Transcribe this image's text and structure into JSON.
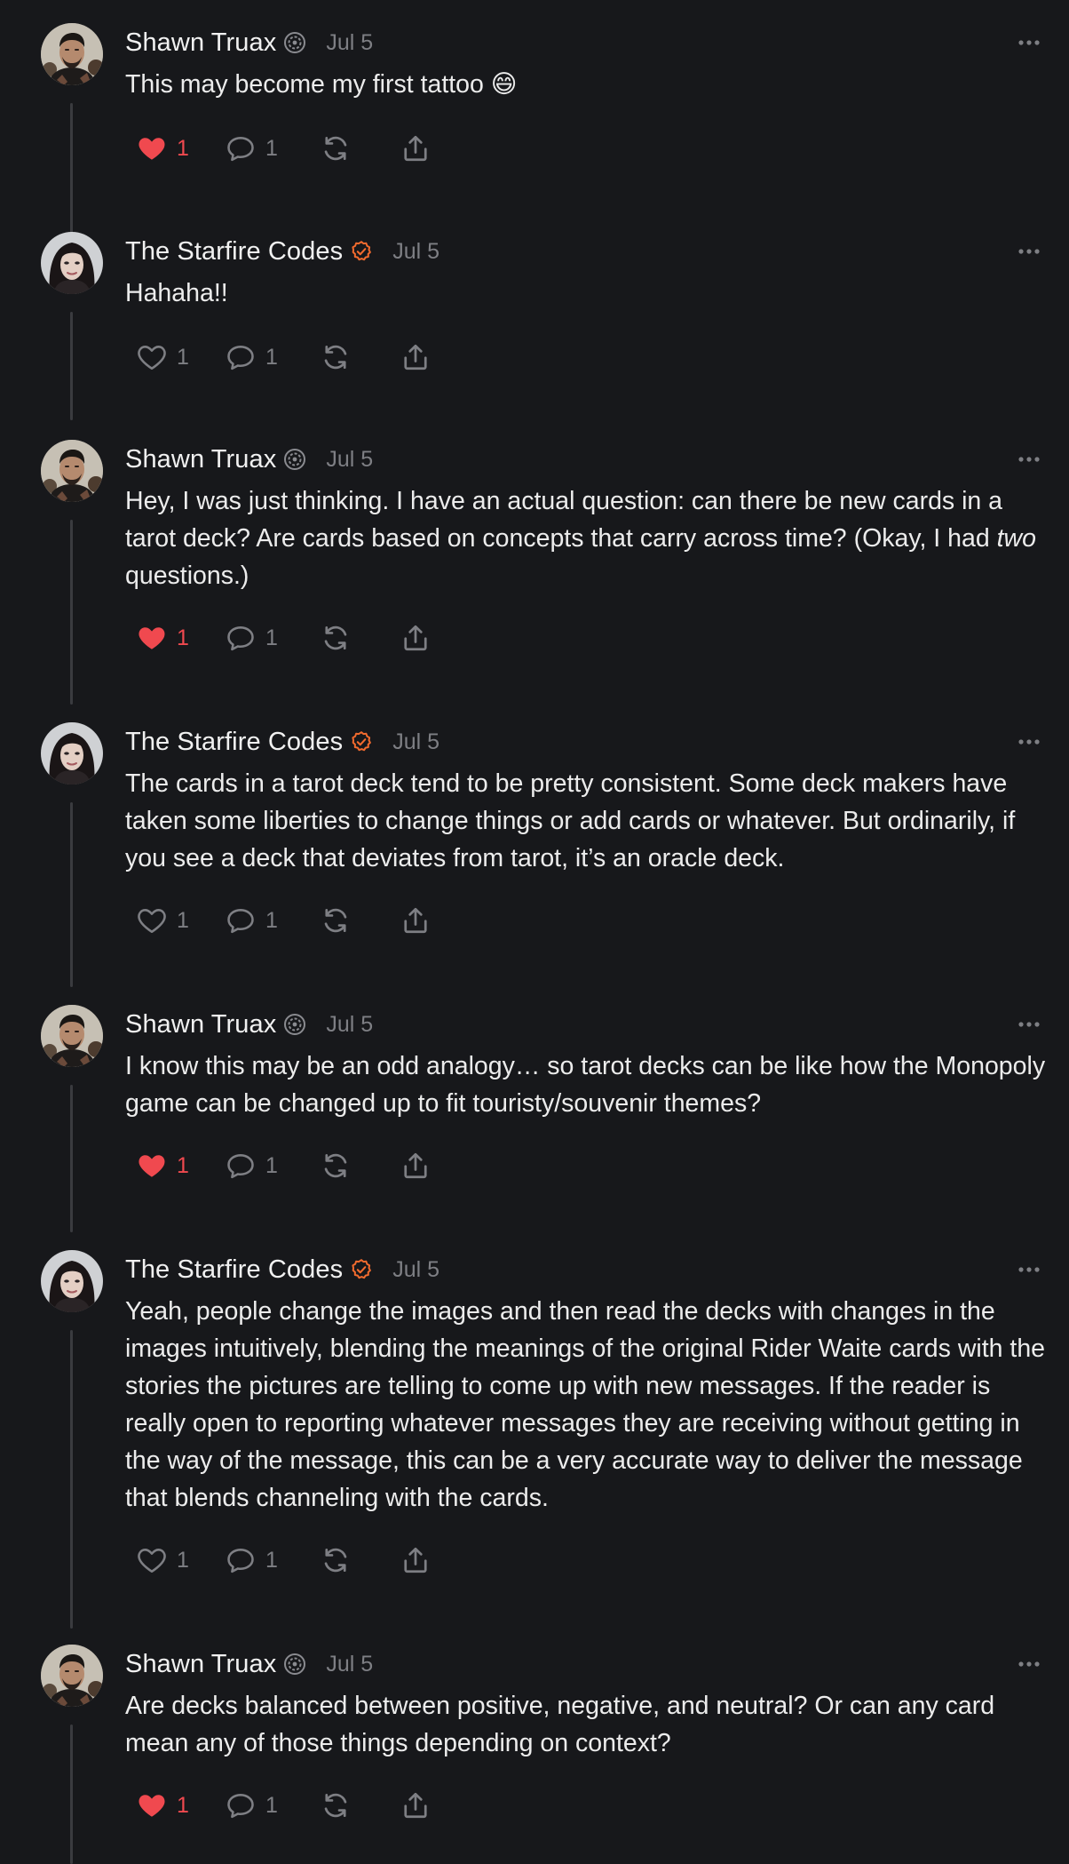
{
  "posts": [
    {
      "author": "Shawn Truax",
      "avatar": "avatar-shawn",
      "badge_icon": "gear-badge-icon",
      "date": "Jul 5",
      "text": "This may become my first tattoo 😄",
      "liked": true,
      "likes": "1",
      "replies": "1"
    },
    {
      "author": "The Starfire Codes",
      "avatar": "avatar-starfire",
      "badge_icon": "verified-check-icon",
      "date": "Jul 5",
      "text": "Hahaha!!",
      "liked": false,
      "likes": "1",
      "replies": "1"
    },
    {
      "author": "Shawn Truax",
      "avatar": "avatar-shawn",
      "badge_icon": "gear-badge-icon",
      "date": "Jul 5",
      "text_parts": [
        "Hey, I was just thinking. I have an actual question: can there be new cards in a tarot deck? Are cards based on concepts that carry across time? (Okay, I had ",
        "two",
        " questions.)"
      ],
      "liked": true,
      "likes": "1",
      "replies": "1"
    },
    {
      "author": "The Starfire Codes",
      "avatar": "avatar-starfire",
      "badge_icon": "verified-check-icon",
      "date": "Jul 5",
      "text": "The cards in a tarot deck tend to be pretty consistent. Some deck makers have taken some liberties to change things or add cards or whatever. But ordinarily, if you see a deck that deviates from tarot, it’s an oracle deck.",
      "liked": false,
      "likes": "1",
      "replies": "1"
    },
    {
      "author": "Shawn Truax",
      "avatar": "avatar-shawn",
      "badge_icon": "gear-badge-icon",
      "date": "Jul 5",
      "text": "I know this may be an odd analogy… so tarot decks can be like how the Monopoly game can be changed up to fit touristy/souvenir themes?",
      "liked": true,
      "likes": "1",
      "replies": "1"
    },
    {
      "author": "The Starfire Codes",
      "avatar": "avatar-starfire",
      "badge_icon": "verified-check-icon",
      "date": "Jul 5",
      "text": "Yeah, people change the images and then read the decks with changes in the images intuitively, blending the meanings of the original Rider Waite cards with the stories the pictures are telling to come up with new messages. If the reader is really open to reporting whatever messages they are receiving without getting in the way of the message, this can be a very accurate way to deliver the message that blends channeling with the cards.",
      "liked": false,
      "likes": "1",
      "replies": "1"
    },
    {
      "author": "Shawn Truax",
      "avatar": "avatar-shawn",
      "badge_icon": "gear-badge-icon",
      "date": "Jul 5",
      "text": "Are decks balanced between positive, negative, and neutral? Or can any card mean any of those things depending on context?",
      "liked": true,
      "likes": "1",
      "replies": "1"
    }
  ],
  "icons": {
    "like": "heart-icon",
    "reply": "speech-bubble-icon",
    "repost": "repost-icon",
    "share": "share-icon",
    "more": "more-dots-icon"
  },
  "colors": {
    "background": "#17181b",
    "liked": "#f0494f",
    "muted": "#7e7f84",
    "verified": "#f26b2e",
    "thread_line": "#3a3b3f"
  }
}
